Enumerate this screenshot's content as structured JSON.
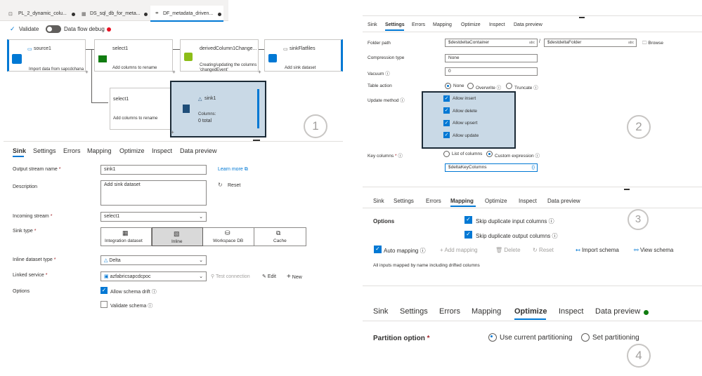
{
  "doc_tabs": [
    {
      "label": "PL_2_dynamic_colu..."
    },
    {
      "label": "DS_sql_db_for_meta..."
    },
    {
      "label": "DF_metadata_driven..."
    }
  ],
  "toolbar": {
    "validate": "Validate",
    "debug": "Data flow debug"
  },
  "nodes": {
    "source1": {
      "title": "source1",
      "desc": "Import data from sapcdchana"
    },
    "select1a": {
      "title": "select1",
      "desc": "Add columns to rename"
    },
    "derived": {
      "title": "derivedColumn1Change...",
      "desc": "Creating/updating the columns 'changedEvent'"
    },
    "sinkflat": {
      "title": "sinkFlatfiles",
      "desc": "Add sink dataset"
    },
    "select1b": {
      "title": "select1",
      "desc": "Add columns to rename"
    },
    "sink1": {
      "title": "sink1",
      "columns": "Columns:",
      "total": "0 total"
    }
  },
  "callouts": [
    "1",
    "2",
    "3",
    "4"
  ],
  "p1": {
    "tabs": [
      "Sink",
      "Settings",
      "Errors",
      "Mapping",
      "Optimize",
      "Inspect",
      "Data preview"
    ],
    "output_stream_label": "Output stream name",
    "output_stream_value": "sink1",
    "learn_more": "Learn more",
    "description_label": "Description",
    "description_value": "Add sink dataset",
    "reset": "Reset",
    "incoming_label": "Incoming stream",
    "incoming_value": "select1",
    "sink_type_label": "Sink type",
    "sink_types": [
      "Integration dataset",
      "Inline",
      "Workspace DB",
      "Cache"
    ],
    "inline_type_label": "Inline dataset type",
    "inline_type_value": "Delta",
    "linked_label": "Linked service",
    "linked_value": "azfabricsapcdcpoc",
    "test_connection": "Test connection",
    "edit": "Edit",
    "new": "New",
    "options_label": "Options",
    "allow_drift": "Allow schema drift",
    "validate_schema": "Validate schema"
  },
  "p2": {
    "tabs": [
      "Sink",
      "Settings",
      "Errors",
      "Mapping",
      "Optimize",
      "Inspect",
      "Data preview"
    ],
    "folder_path_label": "Folder path",
    "folder_container": "$destdeltaContainer",
    "folder_folder": "$destdeltaFolder",
    "browse": "Browse",
    "compression_label": "Compression type",
    "compression_value": "None",
    "vacuum_label": "Vacuum",
    "vacuum_value": "0",
    "table_action_label": "Table action",
    "table_actions": [
      "None",
      "Overwrite",
      "Truncate"
    ],
    "update_label": "Update method",
    "update_methods": [
      "Allow insert",
      "Allow delete",
      "Allow upsert",
      "Allow update"
    ],
    "key_label": "Key columns",
    "key_options": [
      "List of columns",
      "Custom expression"
    ],
    "key_value": "$deltaKeyColumns",
    "abc": "abc"
  },
  "p3": {
    "tabs": [
      "Sink",
      "Settings",
      "Errors",
      "Mapping",
      "Optimize",
      "Inspect",
      "Data preview"
    ],
    "options_label": "Options",
    "skip_input": "Skip duplicate input columns",
    "skip_output": "Skip duplicate output columns",
    "auto_mapping": "Auto mapping",
    "add_mapping": "Add mapping",
    "delete": "Delete",
    "reset": "Reset",
    "import_schema": "Import schema",
    "view_schema": "View schema",
    "note": "All inputs mapped by name including drifted columns"
  },
  "p4": {
    "tabs": [
      "Sink",
      "Settings",
      "Errors",
      "Mapping",
      "Optimize",
      "Inspect",
      "Data preview"
    ],
    "partition_label": "Partition option",
    "current": "Use current partitioning",
    "set": "Set partitioning"
  },
  "colors": {
    "accent": "#0078d4",
    "sink_bg": "#c9d9e6",
    "dark": "#1b2a36",
    "debug_dot": "#e81123",
    "preview_dot": "#107c10"
  }
}
